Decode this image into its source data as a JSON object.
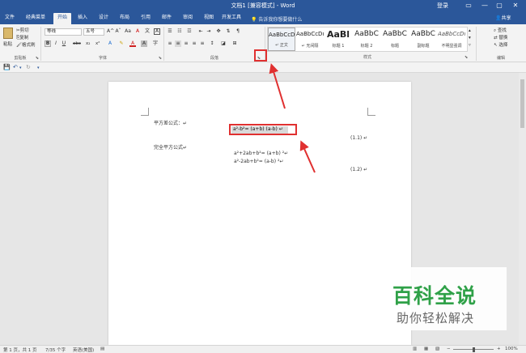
{
  "title_bar": {
    "title": "文档1 [兼容模式] - Word",
    "login": "登录",
    "minimize": "—",
    "restore": "▢",
    "close": "✕"
  },
  "tabs": [
    "文件",
    "经典菜单",
    "开始",
    "插入",
    "设计",
    "布局",
    "引用",
    "邮件",
    "审阅",
    "视图",
    "开发工具"
  ],
  "active_tab": "开始",
  "tell_me": "告诉我你想要做什么",
  "share": "共享",
  "ribbon": {
    "clipboard": {
      "paste": "粘贴",
      "cut": "剪切",
      "copy": "复制",
      "format_painter": "格式刷",
      "label": "剪贴板"
    },
    "font": {
      "font_name": "等线",
      "font_size": "五号",
      "label": "字体",
      "bold": "B",
      "italic": "I",
      "underline": "U",
      "strikethrough": "abc",
      "subscript": "x₂",
      "superscript": "x²",
      "grow": "A^",
      "shrink": "Aˇ",
      "case": "Aa",
      "clear": "A",
      "phonetic": "文",
      "border": "A",
      "highlight": "✎",
      "color": "A",
      "shade": "A",
      "enclose": "字"
    },
    "paragraph": {
      "label": "段落"
    },
    "styles": {
      "label": "样式",
      "items": [
        {
          "sample": "AaBbCcDı",
          "name": "↵ 正文"
        },
        {
          "sample": "AaBbCcDı",
          "name": "↵ 无间隔"
        },
        {
          "sample": "AaBl",
          "name": "标题 1"
        },
        {
          "sample": "AaBbC",
          "name": "标题 2"
        },
        {
          "sample": "AaBbC",
          "name": "标题"
        },
        {
          "sample": "AaBbC",
          "name": "副标题"
        },
        {
          "sample": "AaBbCcDı",
          "name": "不明显强调"
        }
      ]
    },
    "editing": {
      "find": "查找",
      "replace": "替换",
      "select": "选择",
      "label": "编辑"
    }
  },
  "document": {
    "line1": "平方差公式：↵",
    "eq_diff": "a²-b²= (a+b) (a-b) ↵",
    "eq_num1": "(1.1) ↵",
    "line2": "完全平方公式↵",
    "eq_sq1": "a²+2ab+b²= (a+b) ²↵",
    "eq_sq2": "a²-2ab+b²= (a-b) ²↵",
    "eq_num2": "(1.2) ↵"
  },
  "status": {
    "page": "第 1 页，共 1 页",
    "words": "7/35 个字",
    "lang": "英语(美国)",
    "zoom": "100%"
  },
  "watermark": {
    "line1": "百科全说",
    "line2": "助你轻松解决"
  },
  "colors": {
    "brand": "#2b579a",
    "annotation": "#e03030",
    "watermark_green": "#2fa148"
  }
}
